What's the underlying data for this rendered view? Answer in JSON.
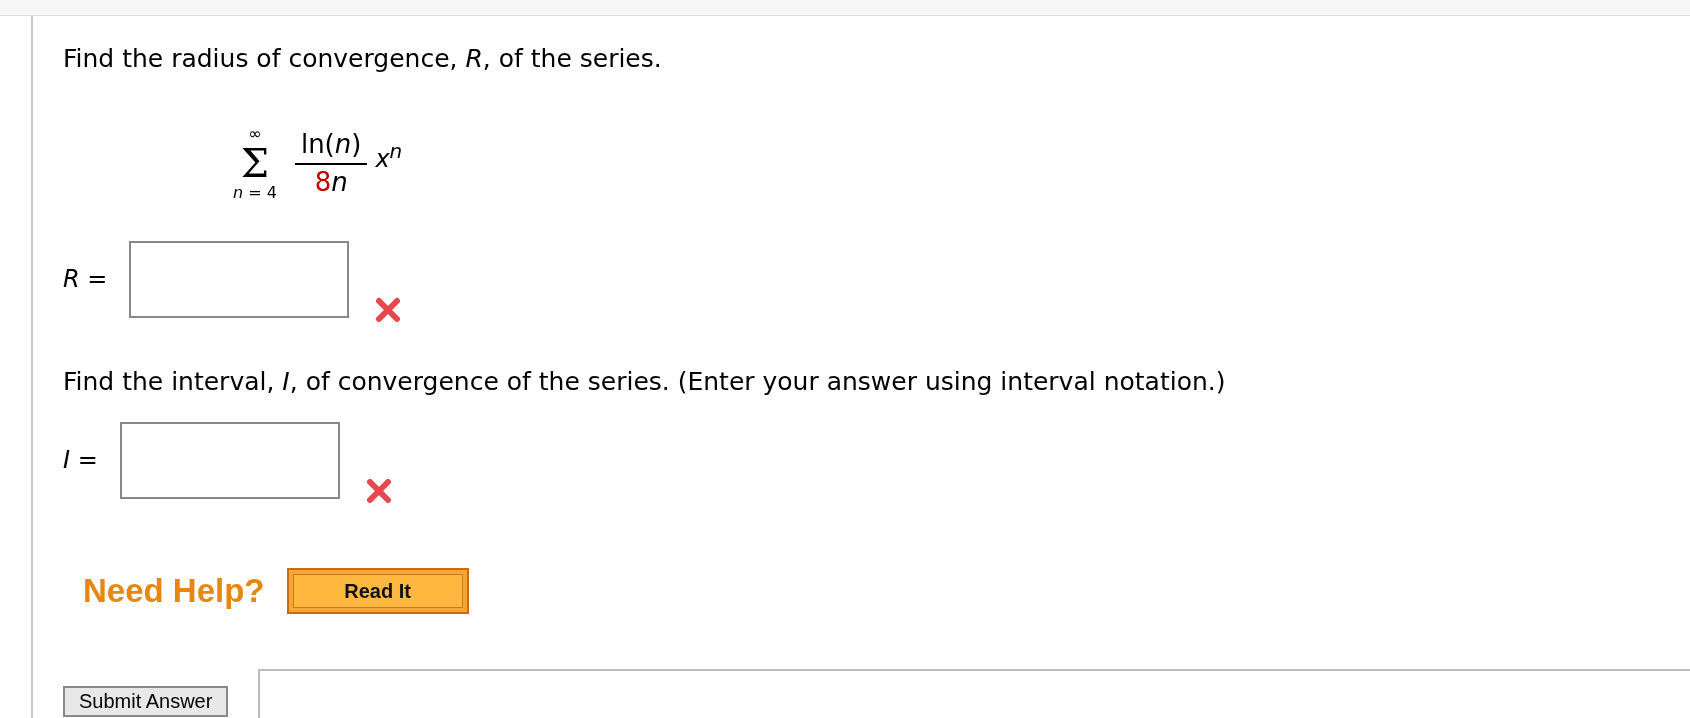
{
  "question_1": "Find the radius of convergence, *R*, of the series.",
  "series": {
    "symbol": "Σ",
    "upper": "∞",
    "lower": "*n* = 4",
    "numerator": "ln(*n*)",
    "denominator_coefficient": "8",
    "denominator_variable": "n",
    "power_base": "x",
    "power_exponent": "n"
  },
  "answer_1": {
    "label": "*R* =",
    "correct": false
  },
  "question_2": "Find the interval, *I*, of convergence of the series. (Enter your answer using interval notation.)",
  "answer_2": {
    "label": "*I* =",
    "correct": false
  },
  "help": {
    "label": "Need Help?",
    "button": "Read It"
  },
  "submit": "Submit Answer"
}
